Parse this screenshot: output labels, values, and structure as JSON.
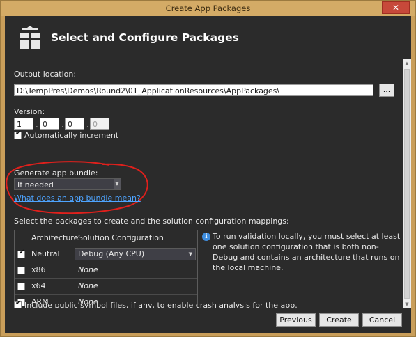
{
  "window": {
    "title": "Create App Packages",
    "close_glyph": "✕"
  },
  "header": {
    "title": "Select and Configure Packages",
    "icon": "package-icon"
  },
  "output": {
    "label": "Output location:",
    "path": "D:\\TempPres\\Demos\\Round2\\01_ApplicationResources\\AppPackages\\",
    "browse_label": "..."
  },
  "version": {
    "label": "Version:",
    "major": "1",
    "minor": "0",
    "build": "0",
    "revision": "0",
    "separator": ".",
    "auto_increment_label": "Automatically increment",
    "auto_increment_checked": true
  },
  "bundle": {
    "label": "Generate app bundle:",
    "selected": "If needed",
    "help_link": "What does an app bundle mean?",
    "annotation_color": "#e0201c"
  },
  "packages": {
    "label": "Select the packages to create and the solution configuration mappings:",
    "columns": [
      "Architecture",
      "Solution Configuration"
    ],
    "rows": [
      {
        "architecture": "Neutral",
        "configuration": "Debug (Any CPU)",
        "checked": true,
        "is_dropdown": true
      },
      {
        "architecture": "x86",
        "configuration": "None",
        "checked": false,
        "is_dropdown": false
      },
      {
        "architecture": "x64",
        "configuration": "None",
        "checked": false,
        "is_dropdown": false
      },
      {
        "architecture": "ARM",
        "configuration": "None",
        "checked": false,
        "is_dropdown": false
      }
    ],
    "info_text": "To run validation locally, you must select at least one solution configuration that is both non-Debug and contains an architecture that runs on the local machine."
  },
  "symbols": {
    "label": "Include public symbol files, if any, to enable crash analysis for the app.",
    "checked": true
  },
  "footer": {
    "previous": "Previous",
    "create": "Create",
    "cancel": "Cancel"
  },
  "colors": {
    "background": "#2b2b2b",
    "frame": "#c99e5a",
    "link": "#4ea4ff",
    "close": "#c7493a"
  }
}
